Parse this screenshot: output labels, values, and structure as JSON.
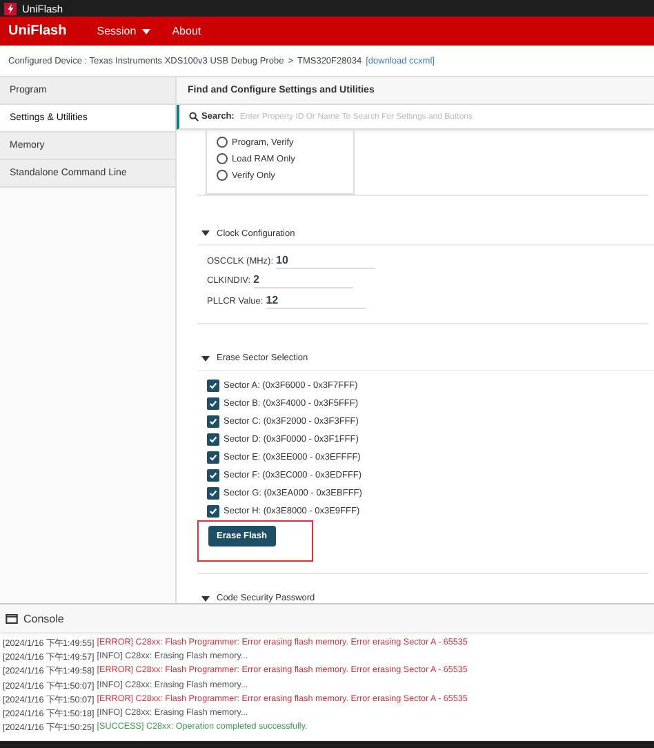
{
  "window": {
    "title": "UniFlash"
  },
  "navbar": {
    "brand": "UniFlash",
    "menus": [
      {
        "label": "Session",
        "dropdown": true
      },
      {
        "label": "About",
        "dropdown": false
      }
    ]
  },
  "breadcrumb": {
    "device": "Configured Device : Texas Instruments XDS100v3 USB Debug Probe",
    "separator": ">",
    "target": "TMS320F28034",
    "link": "[download ccxml]"
  },
  "sidebar": {
    "items": [
      {
        "label": "Program",
        "selected": false
      },
      {
        "label": "Settings & Utilities",
        "selected": true
      },
      {
        "label": "Memory",
        "selected": false
      },
      {
        "label": "Standalone Command Line",
        "selected": false
      }
    ]
  },
  "main": {
    "title": "Find and Configure Settings and Utilities",
    "search": {
      "label": "Search:",
      "placeholder": "Enter Property ID Or Name To Search For Settings and Buttons"
    },
    "radio_options": [
      {
        "label": "Program, Verify",
        "selected": false
      },
      {
        "label": "Load RAM Only",
        "selected": false
      },
      {
        "label": "Verify Only",
        "selected": false
      }
    ],
    "clock": {
      "title": "Clock Configuration",
      "expanded": true,
      "fields": [
        {
          "label": "OSCCLK (MHz):",
          "value": "10"
        },
        {
          "label": "CLKINDIV:",
          "value": "2"
        },
        {
          "label": "PLLCR Value:",
          "value": "12"
        }
      ]
    },
    "erase": {
      "title": "Erase Sector Selection",
      "expanded": true,
      "sectors": [
        {
          "label": "Sector A: (0x3F6000 - 0x3F7FFF)",
          "checked": true
        },
        {
          "label": "Sector B: (0x3F4000 - 0x3F5FFF)",
          "checked": true
        },
        {
          "label": "Sector C: (0x3F2000 - 0x3F3FFF)",
          "checked": true
        },
        {
          "label": "Sector D: (0x3F0000 - 0x3F1FFF)",
          "checked": true
        },
        {
          "label": "Sector E: (0x3EE000 - 0x3EFFFF)",
          "checked": true
        },
        {
          "label": "Sector F: (0x3EC000 - 0x3EDFFF)",
          "checked": true
        },
        {
          "label": "Sector G: (0x3EA000 - 0x3EBFFF)",
          "checked": true
        },
        {
          "label": "Sector H: (0x3E8000 - 0x3E9FFF)",
          "checked": true
        }
      ],
      "button": {
        "label": "Erase Flash",
        "highlighted": true
      }
    },
    "security": {
      "title": "Code Security Password",
      "expanded": true
    }
  },
  "console": {
    "title": "Console",
    "lines": [
      {
        "time": "[2024/1/16 下午1:49:55]",
        "kind": "error",
        "text": "[ERROR] C28xx: Flash Programmer: Error erasing flash memory. Error erasing Sector A - 65535"
      },
      {
        "time": "[2024/1/16 下午1:49:57]",
        "kind": "info",
        "text": "[INFO] C28xx: Erasing Flash memory..."
      },
      {
        "time": "[2024/1/16 下午1:49:58]",
        "kind": "error",
        "text": "[ERROR] C28xx: Flash Programmer: Error erasing flash memory. Error erasing Sector A - 65535"
      },
      {
        "time": "[2024/1/16 下午1:50:07]",
        "kind": "info",
        "text": "[INFO] C28xx: Erasing Flash memory..."
      },
      {
        "time": "[2024/1/16 下午1:50:07]",
        "kind": "error",
        "text": "[ERROR] C28xx: Flash Programmer: Error erasing flash memory. Error erasing Sector A - 65535"
      },
      {
        "time": "[2024/1/16 下午1:50:18]",
        "kind": "info",
        "text": "[INFO] C28xx: Erasing Flash memory..."
      },
      {
        "time": "[2024/1/16 下午1:50:25]",
        "kind": "success",
        "text": "[SUCCESS] C28xx: Operation completed successfully."
      }
    ]
  }
}
